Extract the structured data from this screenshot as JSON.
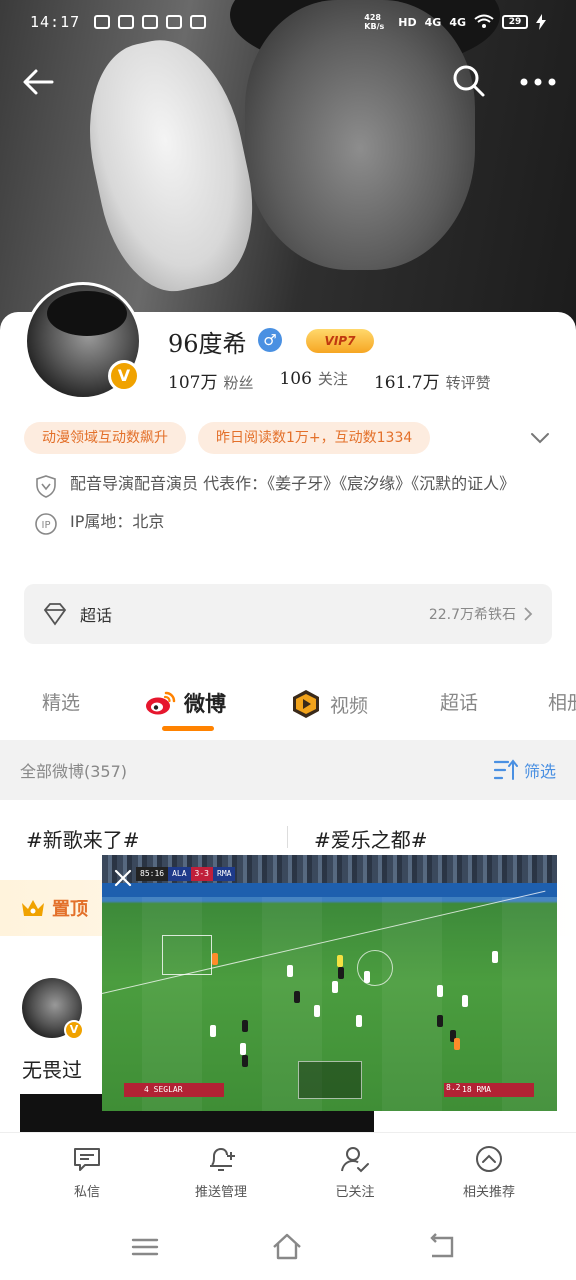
{
  "status_bar": {
    "time": "14:17",
    "net_speed": "428 KB/s",
    "hd": "HD",
    "net1": "4G",
    "net2": "4G",
    "battery": "29"
  },
  "profile": {
    "name": "96度希",
    "vip_label": "VIP7",
    "stats": [
      {
        "value": "107万",
        "label": "粉丝"
      },
      {
        "value": "106",
        "label": "关注"
      },
      {
        "value": "161.7万",
        "label": "转评赞"
      }
    ],
    "pills": [
      "动漫领域互动数飙升",
      "昨日阅读数1万+，互动数1334"
    ],
    "bio": "配音导演配音演员 代表作：《姜子牙》《宸汐缘》《沉默的证人》",
    "ip_location": "IP属地：北京",
    "super_topic_label": "超话",
    "super_topic_right": "22.7万希铁石"
  },
  "tabs": [
    {
      "label": "精选",
      "active": false
    },
    {
      "label": "微博",
      "active": true
    },
    {
      "label": "视频",
      "active": false
    },
    {
      "label": "超话",
      "active": false
    },
    {
      "label": "相册",
      "active": false
    }
  ],
  "feed": {
    "all_posts_label": "全部微博(357)",
    "filter_label": "筛选",
    "topics": [
      "#新歌来了#",
      "#爱乐之都#"
    ],
    "pinned_label": "置顶",
    "post_text": "无畏过"
  },
  "video_pip": {
    "clock": "85:16",
    "home_team": "ALA",
    "score": "3-3",
    "away_team": "RMA",
    "left_player": "4 SEGLAR",
    "right_player": "18 RMA",
    "right_value": "8.2"
  },
  "action_bar": [
    {
      "label": "私信",
      "icon": "message-icon"
    },
    {
      "label": "推送管理",
      "icon": "bell-plus-icon"
    },
    {
      "label": "已关注",
      "icon": "user-check-icon"
    },
    {
      "label": "相关推荐",
      "icon": "chevron-up-circle-icon"
    }
  ],
  "colors": {
    "accent_orange": "#ff8200",
    "pill_text": "#e3702a",
    "pill_bg": "#fdecdf",
    "link_blue": "#4a90e2",
    "vip_gold": "#f6a623"
  }
}
